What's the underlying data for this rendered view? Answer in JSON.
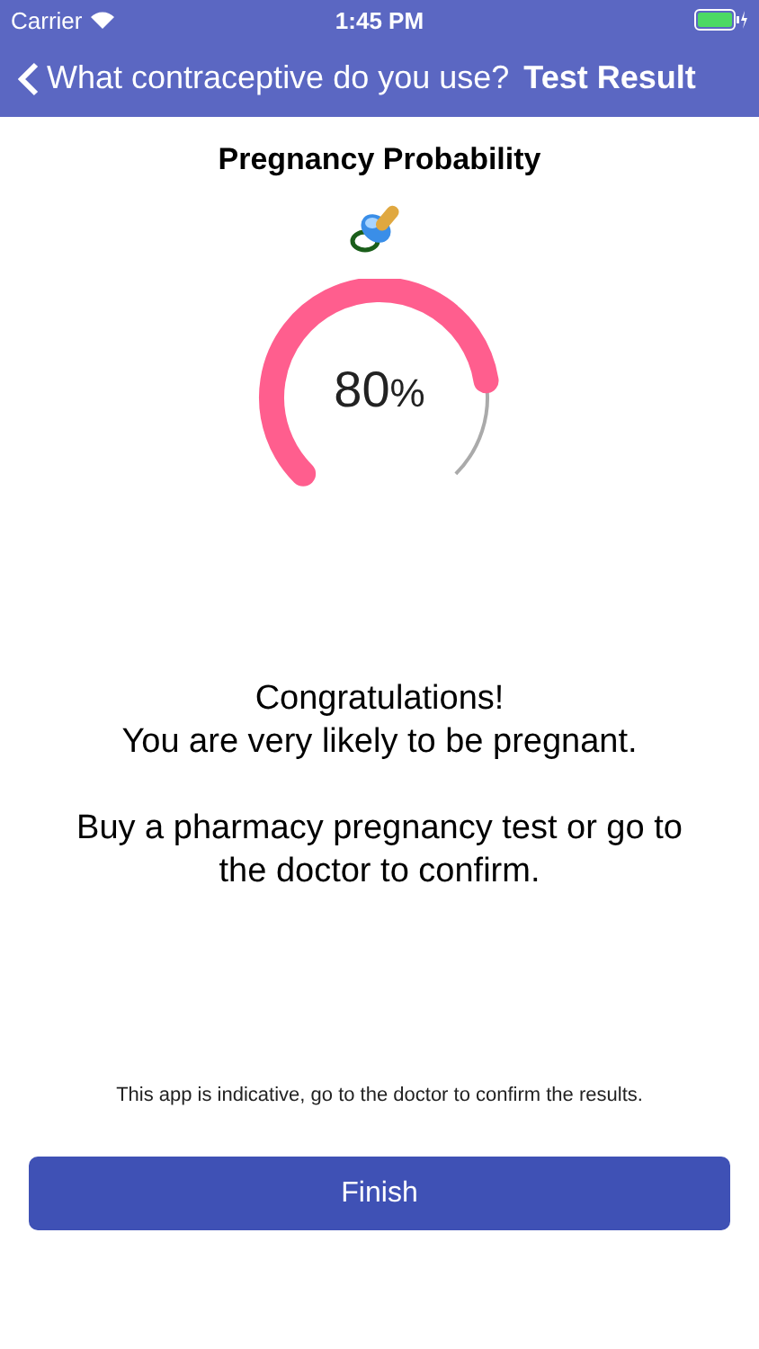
{
  "status_bar": {
    "carrier": "Carrier",
    "time": "1:45 PM"
  },
  "nav": {
    "back": "What contraceptive do you use?",
    "title": "Test Result"
  },
  "heading": "Pregnancy Probability",
  "gauge": {
    "reading": "80",
    "unit": "%"
  },
  "message": [
    "Congratulations!\nYou are very likely to be pregnant.",
    "Buy a pharmacy pregnancy test or go to the doctor to confirm."
  ],
  "disclaimer": "This app is indicative, go to the doctor to confirm the results.",
  "button": "Finish"
}
